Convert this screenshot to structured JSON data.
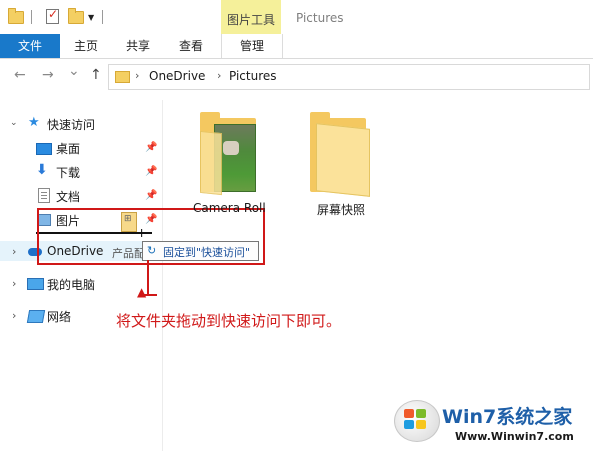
{
  "titlebar": {
    "contextual_tab": "图片工具",
    "window_title": "Pictures"
  },
  "ribbon": {
    "tabs": [
      "文件",
      "主页",
      "共享",
      "查看",
      "管理"
    ]
  },
  "navigation": {
    "back": "←",
    "forward": "→",
    "recent": "⌄",
    "up": "↑",
    "breadcrumb": [
      "OneDrive",
      "Pictures"
    ]
  },
  "sidebar": {
    "quick_access": "快速访问",
    "pinned": [
      "桌面",
      "下载",
      "文档",
      "图片"
    ],
    "onedrive": "OneDrive",
    "partial_item": "产品配",
    "this_pc": "我的电脑",
    "network": "网络"
  },
  "drag_tooltip": "固定到\"快速访问\"",
  "instruction": "将文件夹拖动到快速访问下即可。",
  "folders": [
    {
      "name": "Camera Roll",
      "has_photo": true
    },
    {
      "name": "屏幕快照",
      "has_photo": false
    }
  ],
  "watermark": {
    "brand": "Win7系统之家",
    "url": "Www.Winwin7.com"
  },
  "colors": {
    "file_tab": "#1979ca",
    "contextual_tab": "#f5f09a",
    "annotation_red": "#d01818",
    "tooltip_text": "#1a4f9a"
  }
}
